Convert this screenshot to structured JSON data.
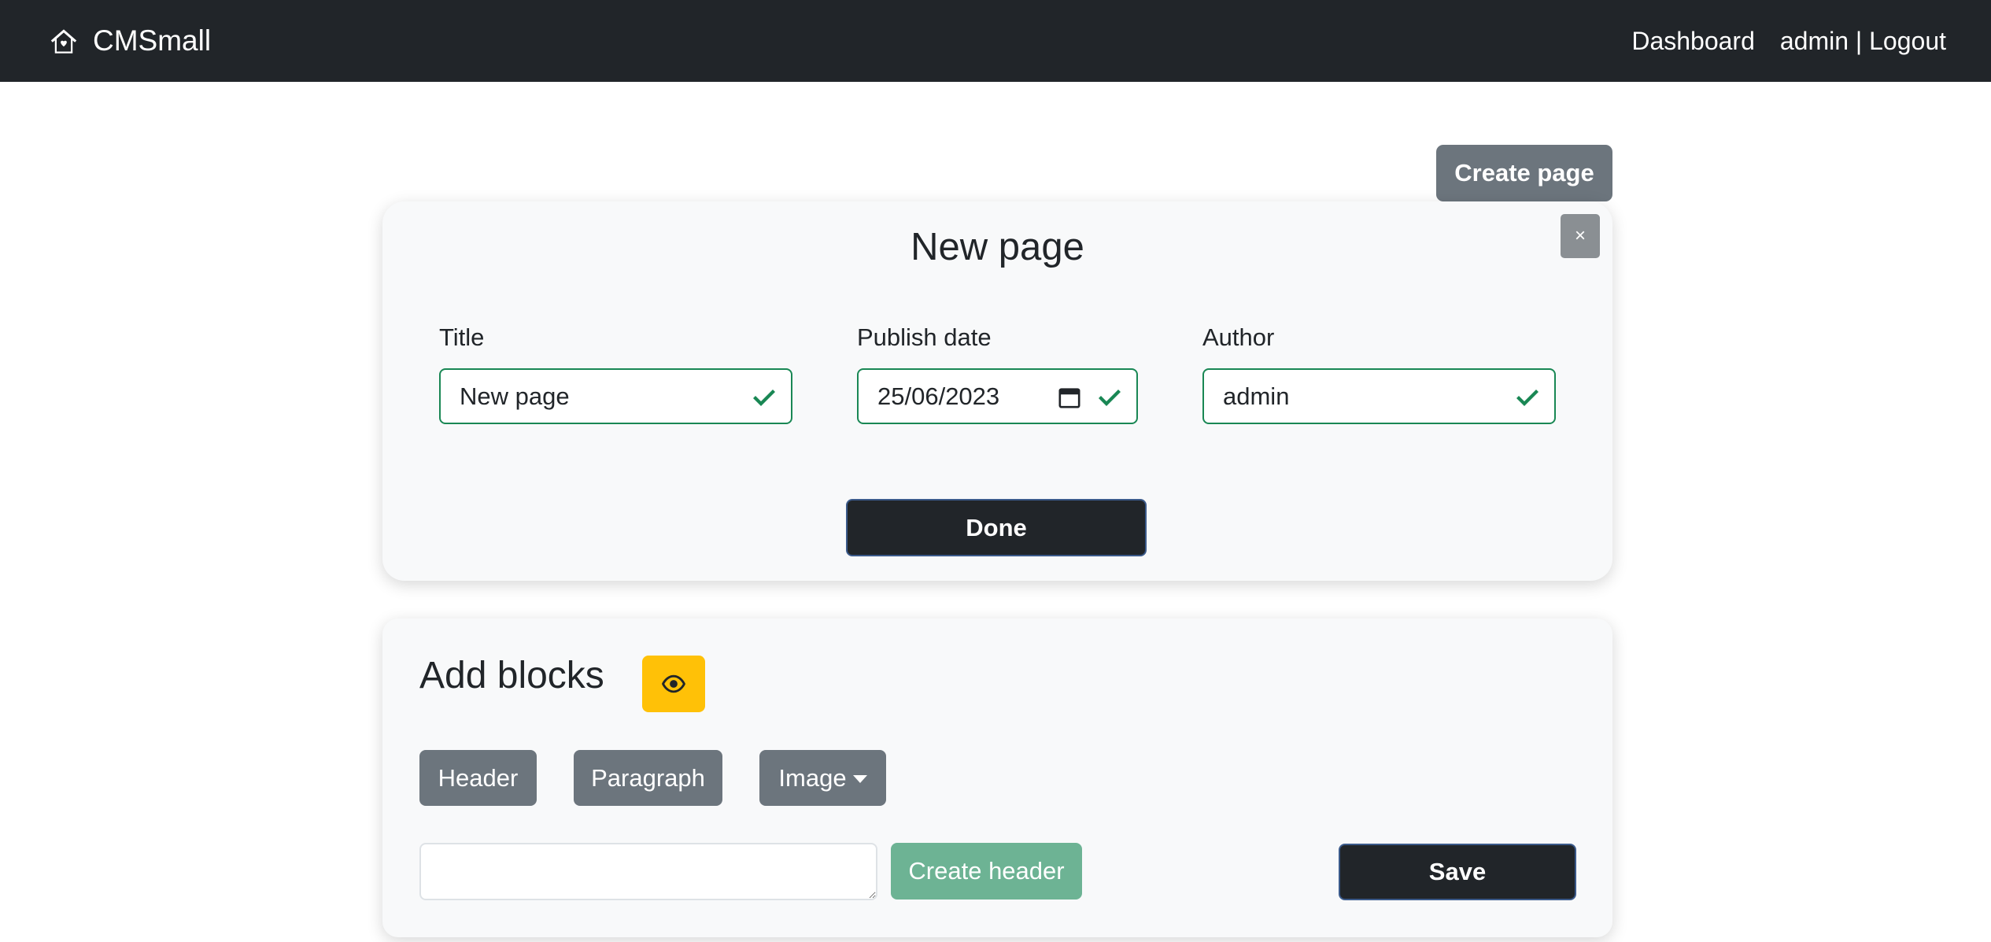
{
  "navbar": {
    "brand_icon": "house-heart-icon",
    "brand": "CMSmall",
    "dashboard": "Dashboard",
    "user": "admin",
    "separator": "|",
    "logout": "Logout"
  },
  "toolbar": {
    "create_page_label": "Create page"
  },
  "new_page_form": {
    "title": "New page",
    "close_label": "×",
    "title_label": "Title",
    "title_value": "New page",
    "publish_label": "Publish date",
    "publish_value": "25/06/2023",
    "author_label": "Author",
    "author_value": "admin",
    "done_label": "Done",
    "valid_color": "#198754"
  },
  "blocks": {
    "title": "Add blocks",
    "preview_icon": "eye-icon",
    "header_label": "Header",
    "paragraph_label": "Paragraph",
    "image_label": "Image",
    "header_input_value": "",
    "create_header_label": "Create header",
    "save_label": "Save"
  },
  "colors": {
    "navbar": "#212529",
    "accent": "#ffc107",
    "secondary": "#6c757d",
    "success": "#198754"
  }
}
